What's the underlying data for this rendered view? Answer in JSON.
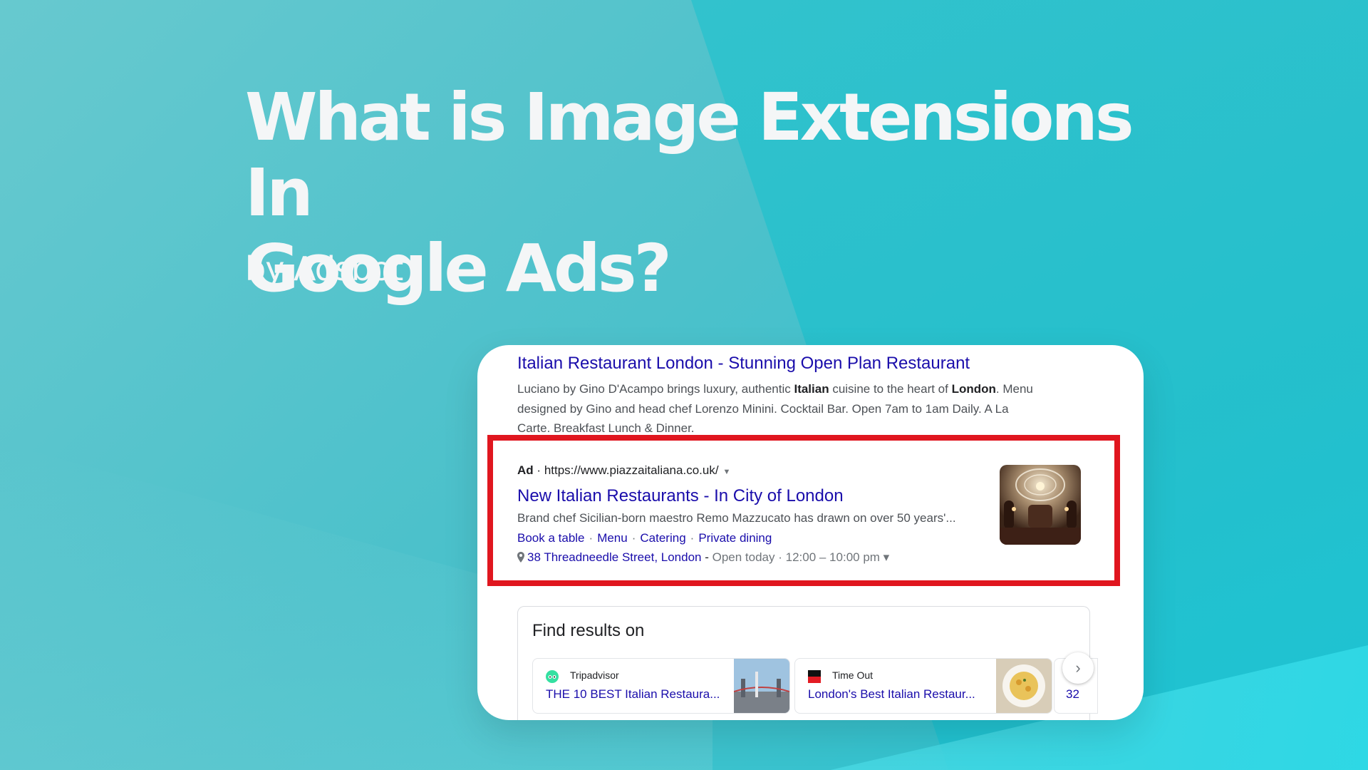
{
  "banner": {
    "headline_line1": "What is Image Extensions In",
    "headline_line2": "Google Ads?",
    "byline": "by Adsbot"
  },
  "colors": {
    "background": "#4cc1cb",
    "highlight_box": "#e0161f",
    "link": "#1a0dab"
  },
  "organic_result": {
    "title": "Italian Restaurant London - Stunning Open Plan Restaurant",
    "desc_part1": "Luciano by Gino D'Acampo brings luxury, authentic ",
    "desc_bold1": "Italian",
    "desc_part2": " cuisine to the heart of ",
    "desc_bold2": "London",
    "desc_part3": ". Menu designed by Gino and head chef Lorenzo Minini. Cocktail Bar. Open 7am to 1am Daily. A La Carte. Breakfast Lunch & Dinner."
  },
  "ad_result": {
    "label": "Ad",
    "separator": "·",
    "url": "https://www.piazzaitaliana.co.uk/",
    "caret": "▼",
    "title": "New Italian Restaurants - In City of London",
    "description": "Brand chef Sicilian-born maestro Remo Mazzucato has drawn on over 50 years'...",
    "sitelinks": [
      "Book a table",
      "Menu",
      "Catering",
      "Private dining"
    ],
    "sitelink_separator": "·",
    "address": "38 Threadneedle Street, London",
    "address_dash": " - ",
    "hours": "Open today · 12:00 – 10:00 pm",
    "hours_caret": "▾",
    "image_icon": "restaurant-interior-image"
  },
  "find_results": {
    "title": "Find results on",
    "sources": [
      {
        "name": "Tripadvisor",
        "link": "THE 10 BEST Italian Restaura...",
        "icon": "tripadvisor-logo-icon"
      },
      {
        "name": "Time Out",
        "link": "London's Best Italian Restaur...",
        "icon": "timeout-logo-icon"
      }
    ],
    "partial_link": "32",
    "next_icon": "›"
  }
}
